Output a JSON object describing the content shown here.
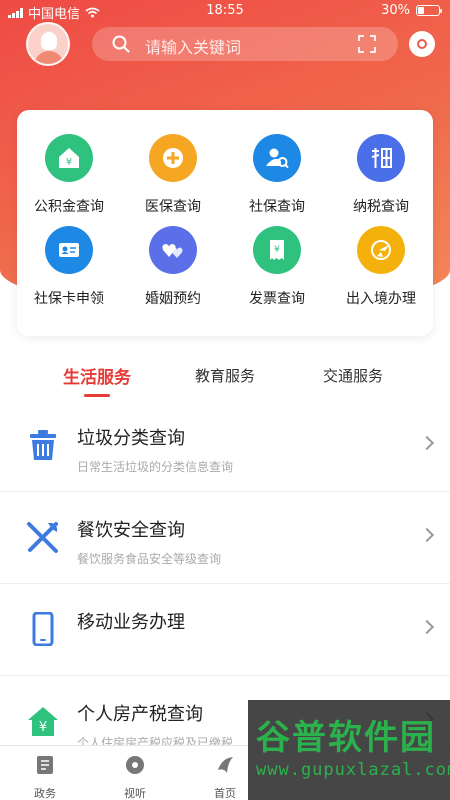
{
  "status_bar": {
    "carrier": "中国电信",
    "time": "18:55",
    "battery": "30%",
    "battery_level": 0.3
  },
  "header": {
    "search_placeholder": "请输入关键词"
  },
  "services": [
    {
      "label": "公积金查询",
      "icon": "housing-fund-icon",
      "color": "#2ec27e"
    },
    {
      "label": "医保查询",
      "icon": "medical-insurance-icon",
      "color": "#f5a623"
    },
    {
      "label": "社保查询",
      "icon": "social-security-icon",
      "color": "#1e88e5"
    },
    {
      "label": "纳税查询",
      "icon": "tax-icon",
      "color": "#4a6fe8"
    },
    {
      "label": "社保卡申领",
      "icon": "id-card-icon",
      "color": "#1e88e5"
    },
    {
      "label": "婚姻预约",
      "icon": "hearts-icon",
      "color": "#5a6fe8"
    },
    {
      "label": "发票查询",
      "icon": "invoice-icon",
      "color": "#2ec27e"
    },
    {
      "label": "出入境办理",
      "icon": "airplane-globe-icon",
      "color": "#f5b10b"
    }
  ],
  "tabs": [
    {
      "label": "生活服务",
      "active": true
    },
    {
      "label": "教育服务",
      "active": false
    },
    {
      "label": "交通服务",
      "active": false
    }
  ],
  "list": [
    {
      "title": "垃圾分类查询",
      "subtitle": "日常生活垃圾的分类信息查询",
      "icon": "trash-can-icon"
    },
    {
      "title": "餐饮安全查询",
      "subtitle": "餐饮服务食品安全等级查询",
      "icon": "fork-knife-icon"
    },
    {
      "title": "移动业务办理",
      "subtitle": "",
      "icon": "mobile-phone-icon"
    },
    {
      "title": "个人房产税查询",
      "subtitle": "个人住房房产税应税及已缴税",
      "icon": "house-yuan-icon"
    }
  ],
  "tabbar": [
    {
      "label": "政务",
      "icon": "document-icon"
    },
    {
      "label": "视听",
      "icon": "disc-icon"
    },
    {
      "label": "首页",
      "icon": "home-icon"
    }
  ],
  "watermark": {
    "title": "谷普软件园",
    "url": "www.gupuxlazal.com"
  },
  "colors": {
    "primary": "#e63b36",
    "hero_start": "#ef4a45",
    "hero_end": "#f48a5a",
    "list_icon": "#3d7be0",
    "list_icon_green": "#2ec27e"
  }
}
